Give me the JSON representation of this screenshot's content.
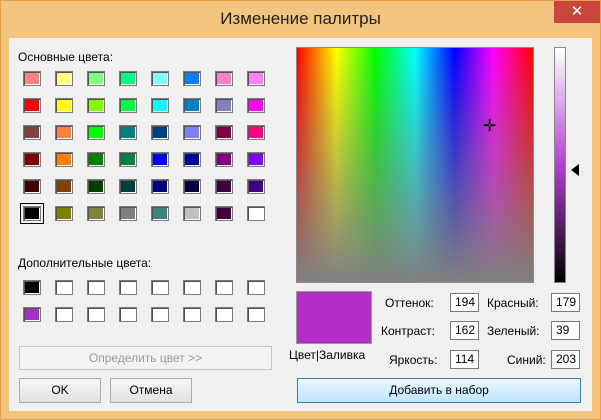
{
  "window": {
    "title": "Изменение палитры",
    "close_glyph": "✕"
  },
  "basic_colors": {
    "label": "Основные цвета:",
    "rows": [
      [
        "#ff8080",
        "#ffff80",
        "#80ff80",
        "#00ff80",
        "#80ffff",
        "#0080ff",
        "#ff80c0",
        "#ff80ff"
      ],
      [
        "#ff0000",
        "#ffff00",
        "#80ff00",
        "#00ff40",
        "#00ffff",
        "#0080c0",
        "#8080c0",
        "#ff00ff"
      ],
      [
        "#804040",
        "#ff8040",
        "#00ff00",
        "#008080",
        "#004080",
        "#8080ff",
        "#800040",
        "#ff0080"
      ],
      [
        "#800000",
        "#ff8000",
        "#008000",
        "#008040",
        "#0000ff",
        "#0000a0",
        "#800080",
        "#8000ff"
      ],
      [
        "#400000",
        "#804000",
        "#004000",
        "#004040",
        "#000080",
        "#000040",
        "#400040",
        "#400080"
      ],
      [
        "#000000",
        "#808000",
        "#808040",
        "#808080",
        "#408080",
        "#c0c0c0",
        "#400040",
        "#ffffff"
      ]
    ]
  },
  "custom_colors": {
    "label": "Дополнительные цвета:",
    "rows": [
      [
        "#000000",
        "#ffffff",
        "#ffffff",
        "#ffffff",
        "#ffffff",
        "#ffffff",
        "#ffffff",
        "#ffffff"
      ],
      [
        "#a52fc3",
        "#ffffff",
        "#ffffff",
        "#ffffff",
        "#ffffff",
        "#ffffff",
        "#ffffff",
        "#ffffff"
      ]
    ]
  },
  "buttons": {
    "define": "Определить цвет >>",
    "ok": "OK",
    "cancel": "Отмена",
    "add": "Добавить в набор"
  },
  "preview": {
    "label": "Цвет|Заливка",
    "color": "#b32ec4"
  },
  "fields": {
    "hue": {
      "label": "Оттенок:",
      "value": "194"
    },
    "sat": {
      "label": "Контраст:",
      "value": "162"
    },
    "lum": {
      "label": "Яркость:",
      "value": "114"
    },
    "red": {
      "label": "Красный:",
      "value": "179"
    },
    "green": {
      "label": "Зеленый:",
      "value": "39"
    },
    "blue": {
      "label": "Синий:",
      "value": "203"
    }
  }
}
